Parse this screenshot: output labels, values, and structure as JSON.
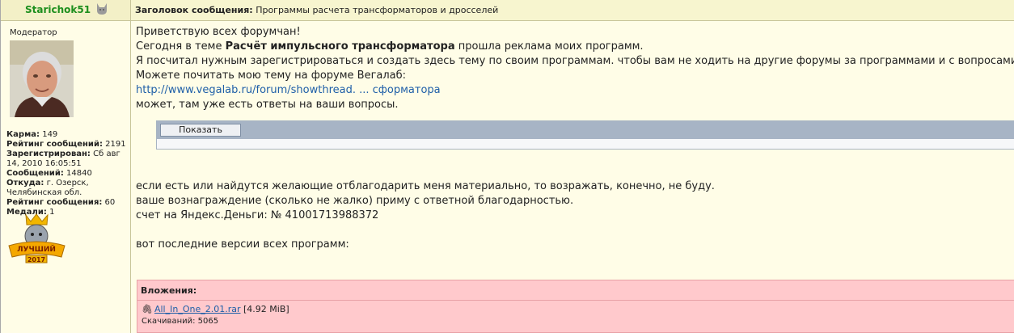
{
  "author": {
    "username": "Starichok51",
    "rank": "Модератор",
    "stats": [
      {
        "label": "Карма:",
        "value": "149"
      },
      {
        "label": "Рейтинг сообщений:",
        "value": "2191"
      },
      {
        "label": "Зарегистрирован:",
        "value": "Сб авг 14, 2010 16:05:51"
      },
      {
        "label": "Сообщений:",
        "value": "14840"
      },
      {
        "label": "Откуда:",
        "value": "г. Озерск, Челябинская обл."
      },
      {
        "label": "Рейтинг сообщения:",
        "value": "60"
      },
      {
        "label": "Медали:",
        "value": "1"
      }
    ],
    "medal_text": "ЛУЧШИЙ",
    "medal_year": "2017"
  },
  "header": {
    "subject_label": "Заголовок сообщения:",
    "subject": "Программы расчета трансформаторов и дросселей"
  },
  "post": {
    "line1": "Приветствую всех форумчан!",
    "line2_pre": "Сегодня в теме ",
    "line2_bold": "Расчёт импульсного трансформатора",
    "line2_post": " прошла реклама моих программ.",
    "line3": "Я посчитал нужным зарегистрироваться и создать здесь тему по своим программам. чтобы вам не ходить на другие форумы за программами и с вопросами.",
    "line4": "Можете почитать мою тему на форуме Вегалаб:",
    "link": "http://www.vegalab.ru/forum/showthread. ... сформатора",
    "line6": "может, там уже есть ответы на ваши вопросы.",
    "spoiler_button": "Показать",
    "line7": "если есть или найдутся желающие отблагодарить меня материально, то возражать, конечно, не буду.",
    "line8": "ваше вознаграждение (сколько не жалко) приму с ответной благодарностью.",
    "line9": "счет на Яндекс.Деньги: № 41001713988372",
    "line10": "вот последние версии всех программ:"
  },
  "attachments": {
    "title": "Вложения:",
    "file_name": "All_In_One_2.01.rar",
    "file_size": "[4.92 MiB]",
    "downloads": "Скачиваний: 5065"
  },
  "colors": {
    "username": "#1d8f1d",
    "link": "#1f5fa8",
    "attachment_bg": "#ffc9cc",
    "spoiler_bar": "#a7b4c5"
  }
}
